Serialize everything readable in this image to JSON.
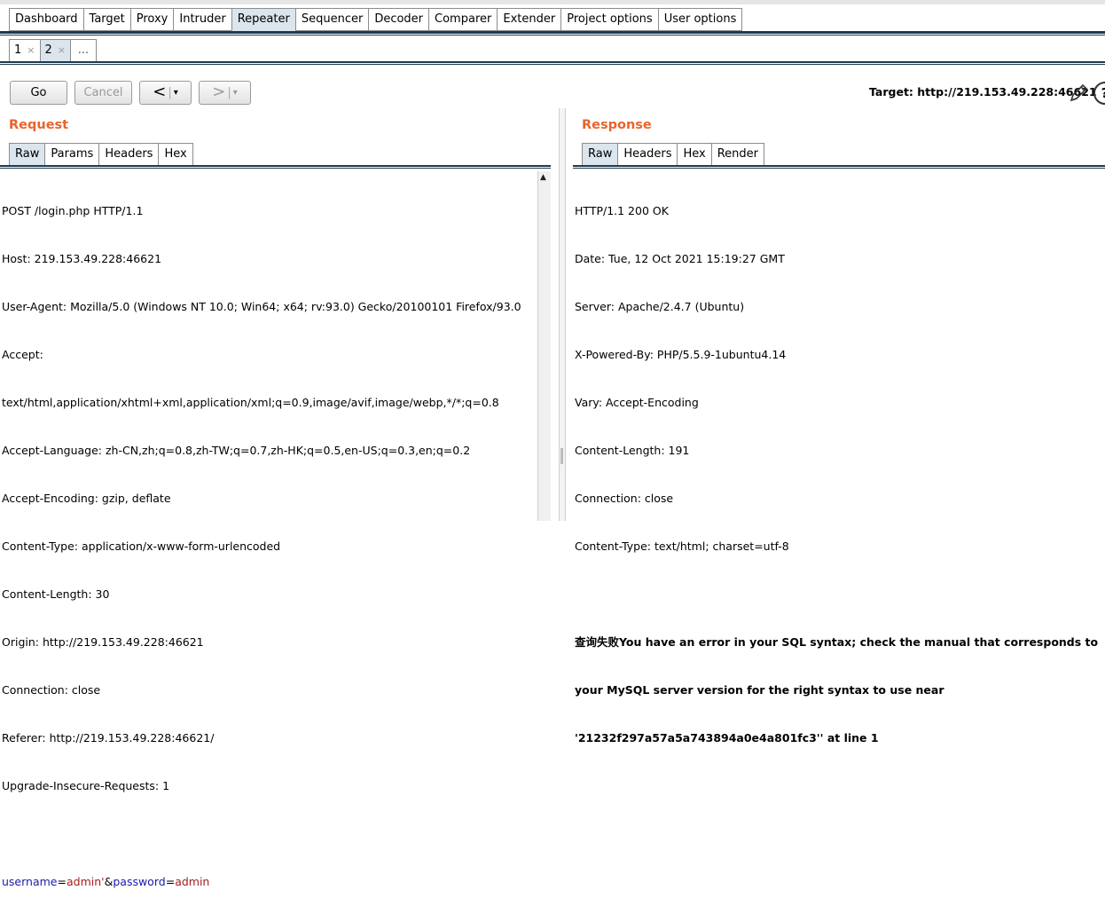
{
  "main_tabs": [
    "Dashboard",
    "Target",
    "Proxy",
    "Intruder",
    "Repeater",
    "Sequencer",
    "Decoder",
    "Comparer",
    "Extender",
    "Project options",
    "User options"
  ],
  "active_main_tab": "Repeater",
  "sub_tabs": [
    {
      "label": "1",
      "close": "×"
    },
    {
      "label": "2",
      "close": "×"
    },
    {
      "label": "..."
    }
  ],
  "toolbar": {
    "go": "Go",
    "cancel": "Cancel",
    "back": "<",
    "forward": ">",
    "dropdown": "▾",
    "target": "Target: http://219.153.49.228:46621",
    "help": "?"
  },
  "request": {
    "title": "Request",
    "tabs": [
      "Raw",
      "Params",
      "Headers",
      "Hex"
    ],
    "lines": [
      "POST /login.php HTTP/1.1",
      "Host: 219.153.49.228:46621",
      "User-Agent: Mozilla/5.0 (Windows NT 10.0; Win64; x64; rv:93.0) Gecko/20100101 Firefox/93.0",
      "Accept:",
      "text/html,application/xhtml+xml,application/xml;q=0.9,image/avif,image/webp,*/*;q=0.8",
      "Accept-Language: zh-CN,zh;q=0.8,zh-TW;q=0.7,zh-HK;q=0.5,en-US;q=0.3,en;q=0.2",
      "Accept-Encoding: gzip, deflate",
      "Content-Type: application/x-www-form-urlencoded",
      "Content-Length: 30",
      "Origin: http://219.153.49.228:46621",
      "Connection: close",
      "Referer: http://219.153.49.228:46621/",
      "Upgrade-Insecure-Requests: 1",
      ""
    ],
    "body": {
      "p1_name": "username",
      "eq1": "=",
      "p1_value": "admin'",
      "amp": "&",
      "p2_name": "password",
      "eq2": "=",
      "p2_value": "admin"
    }
  },
  "response": {
    "title": "Response",
    "tabs": [
      "Raw",
      "Headers",
      "Hex",
      "Render"
    ],
    "lines": [
      "HTTP/1.1 200 OK",
      "Date: Tue, 12 Oct 2021 15:19:27 GMT",
      "Server: Apache/2.4.7 (Ubuntu)",
      "X-Powered-By: PHP/5.5.9-1ubuntu4.14",
      "Vary: Accept-Encoding",
      "Content-Length: 191",
      "Connection: close",
      "Content-Type: text/html; charset=utf-8",
      ""
    ],
    "body_lines": [
      "查询失败You have an error in your SQL syntax; check the manual that corresponds to",
      "your MySQL server version for the right syntax to use near",
      "'21232f297a57a5a743894a0e4a801fc3'' at line 1"
    ]
  },
  "colors": {
    "accent": "#e8642c",
    "tab_active": "#dbe5ee",
    "rule": "#1f3a4d",
    "param_name": "#1a1aa8",
    "param_value": "#a61c1c"
  },
  "icons": {
    "edit": "pencil-icon",
    "help": "help-icon",
    "scroll_up": "scroll-up-arrow-icon"
  }
}
